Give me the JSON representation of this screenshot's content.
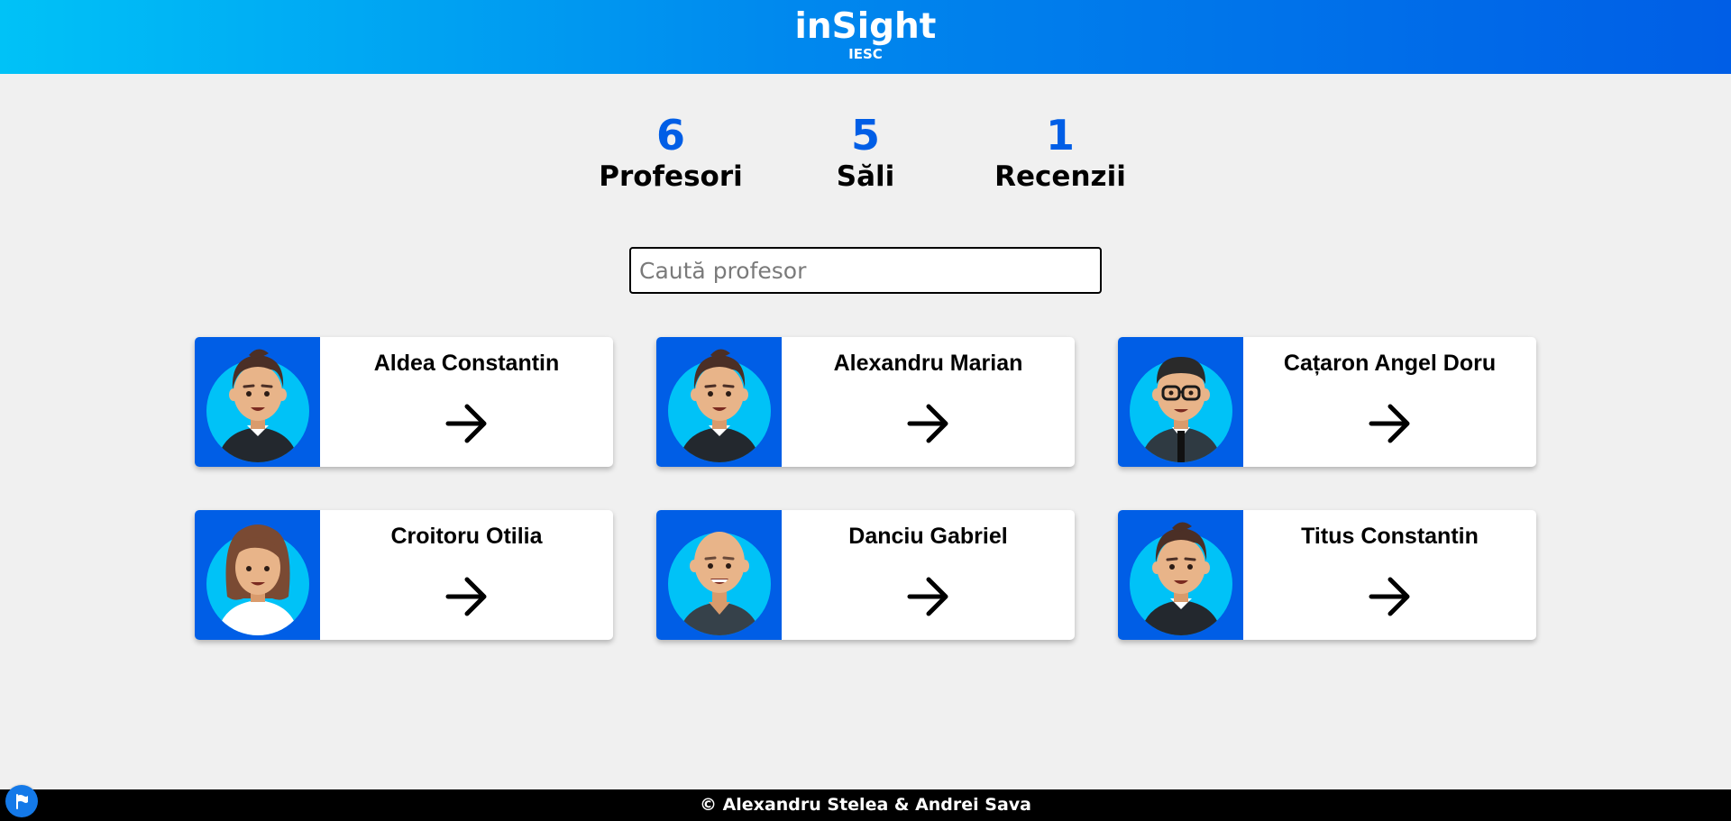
{
  "header": {
    "title": "inSight",
    "subtitle": "IESC"
  },
  "stats": [
    {
      "value": "6",
      "label": "Profesori"
    },
    {
      "value": "5",
      "label": "Săli"
    },
    {
      "value": "1",
      "label": "Recenzii"
    }
  ],
  "search": {
    "placeholder": "Caută profesor",
    "value": ""
  },
  "professors": [
    {
      "name": "Aldea Constantin",
      "avatar": "male-avatar-icon"
    },
    {
      "name": "Alexandru Marian",
      "avatar": "male-avatar-icon"
    },
    {
      "name": "Cațaron Angel Doru",
      "avatar": "male-glasses-avatar-icon"
    },
    {
      "name": "Croitoru Otilia",
      "avatar": "female-avatar-icon"
    },
    {
      "name": "Danciu Gabriel",
      "avatar": "bald-male-avatar-icon"
    },
    {
      "name": "Titus Constantin",
      "avatar": "male-avatar-icon"
    }
  ],
  "footer": {
    "text": "© Alexandru Stelea & Andrei Sava"
  },
  "colors": {
    "primary": "#005ee6",
    "accent": "#00c2f7",
    "background": "#f0f0f0"
  }
}
